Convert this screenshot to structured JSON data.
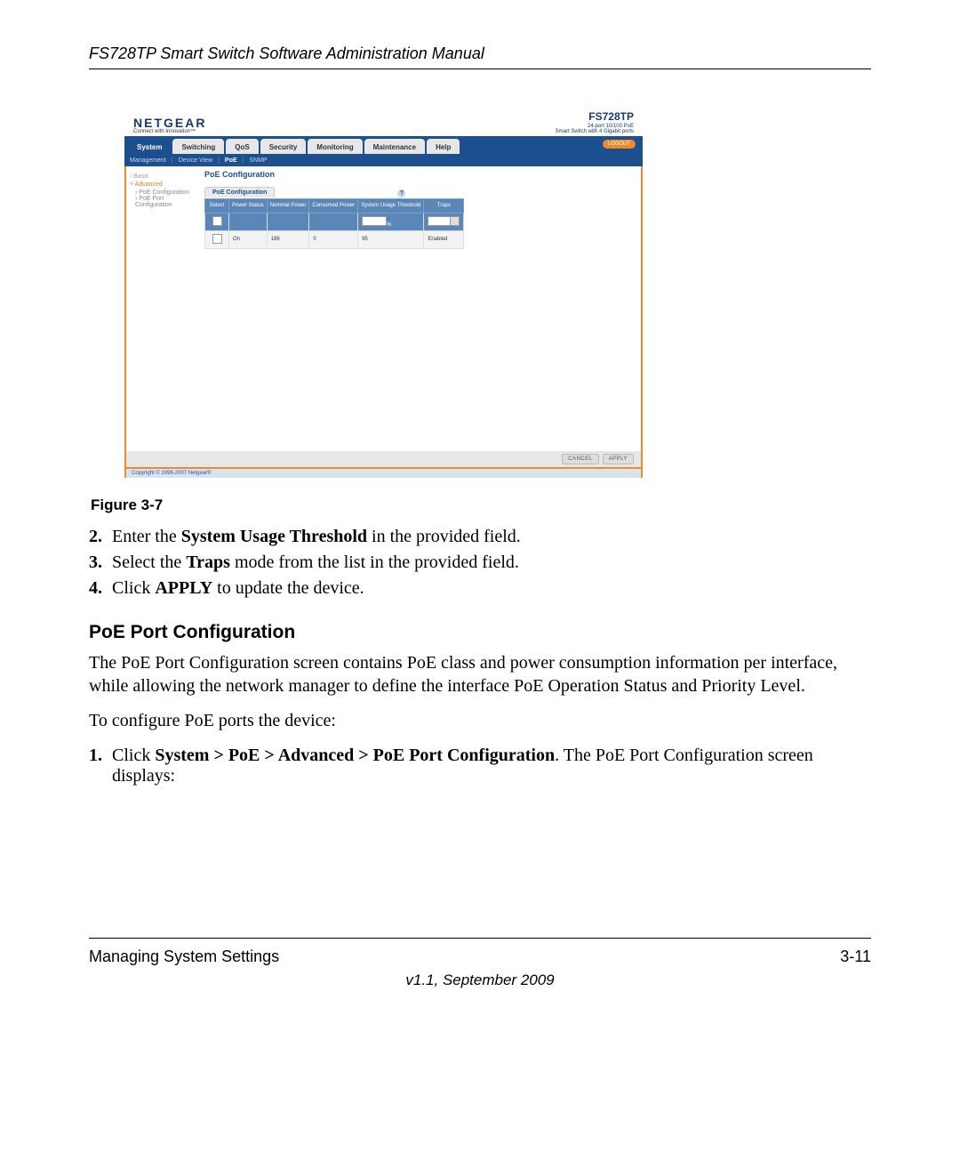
{
  "header": {
    "title": "FS728TP Smart Switch Software Administration Manual"
  },
  "screenshot": {
    "brand": "NETGEAR",
    "brand_tag": "Connect with Innovation™",
    "model": {
      "name": "FS728TP",
      "line1": "24-port 10/100 PoE",
      "line2": "Smart Switch with 4 Gigabit ports"
    },
    "logout": "LOGOUT",
    "tabs": [
      "System",
      "Switching",
      "QoS",
      "Security",
      "Monitoring",
      "Maintenance",
      "Help"
    ],
    "active_tab": "System",
    "subtabs": [
      "Management",
      "Device View",
      "PoE",
      "SNMP"
    ],
    "active_subtab": "PoE",
    "sidebar": {
      "items": [
        "Basic",
        "Advanced"
      ],
      "active": "Advanced",
      "children": [
        "PoE Configuration",
        "PoE Port Configuration"
      ],
      "child_active": "PoE Configuration"
    },
    "panel_title": "PoE Configuration",
    "inner_tab": "PoE Configuration",
    "table": {
      "headers": [
        "Select",
        "Power Status",
        "Nominal Power",
        "Consumed Power",
        "System Usage Threshold",
        "Traps"
      ],
      "input_row": {
        "threshold_suffix": "%"
      },
      "data_row": [
        "",
        "On",
        "186",
        "0",
        "95",
        "Enabled"
      ]
    },
    "buttons": {
      "cancel": "CANCEL",
      "apply": "APPLY"
    },
    "copyright": "Copyright © 1996-2007 Netgear®"
  },
  "figure_label": "Figure 3-7",
  "steps_top": [
    {
      "n": "2.",
      "pre": "Enter the ",
      "bold": "System Usage Threshold",
      "post": " in the provided field."
    },
    {
      "n": "3.",
      "pre": "Select the ",
      "bold": "Traps",
      "post": " mode from the list in the provided field."
    },
    {
      "n": "4.",
      "pre": "Click ",
      "bold": "APPLY",
      "post": " to update the device."
    }
  ],
  "section": {
    "heading": "PoE Port Configuration",
    "p1": "The PoE Port Configuration screen contains PoE class and power consumption information per interface, while allowing the network manager to define the interface PoE Operation Status and Priority Level.",
    "p2": "To configure PoE ports the device:",
    "step": {
      "n": "1.",
      "pre": "Click ",
      "bold": "System > PoE > Advanced > PoE Port Configuration",
      "post": ". The PoE Port Configuration screen displays:"
    }
  },
  "footer": {
    "left": "Managing System Settings",
    "right": "3-11",
    "version": "v1.1, September 2009"
  }
}
